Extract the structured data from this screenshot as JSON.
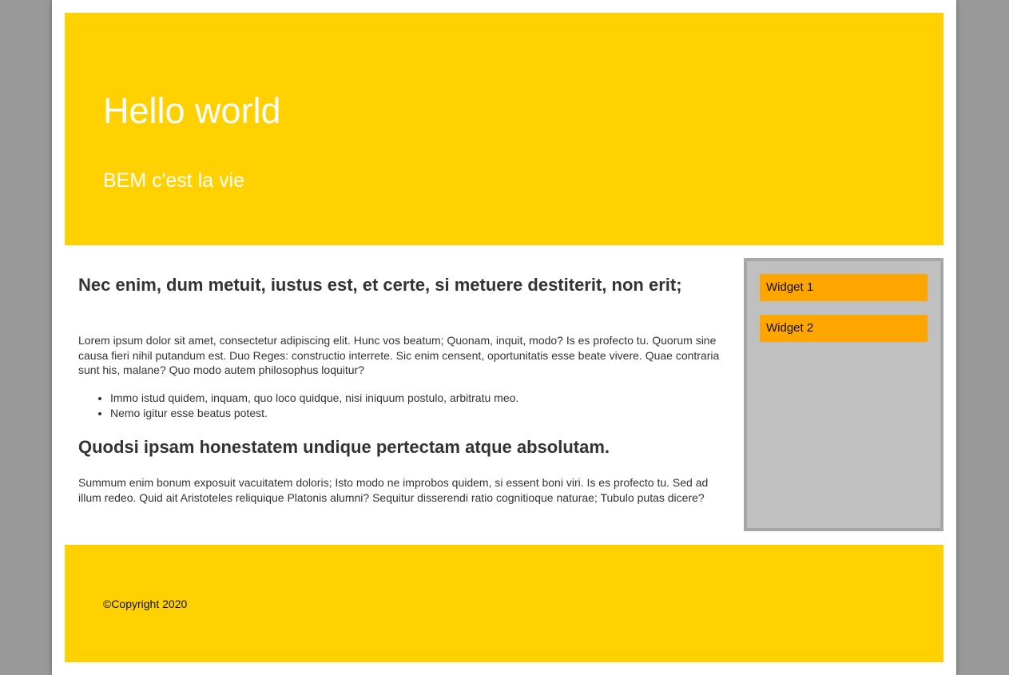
{
  "colors": {
    "backdrop": "#999999",
    "page": "#ffffff",
    "header_bg": "#ffd100",
    "footer_bg": "#ffd100",
    "widget_bg": "#ffa500",
    "sidebar_bg": "#c0c0c0",
    "sidebar_border": "#a6a6a6",
    "text": "#333333"
  },
  "header": {
    "title": "Hello world",
    "subtitle": "BEM c'est la vie"
  },
  "main": {
    "heading1": "Nec enim, dum metuit, iustus est, et certe, si metuere destiterit, non erit;",
    "paragraph1": "Lorem ipsum dolor sit amet, consectetur adipiscing elit. Hunc vos beatum; Quonam, inquit, modo? Is es profecto tu. Quorum sine causa fieri nihil putandum est. Duo Reges: constructio interrete. Sic enim censent, oportunitatis esse beate vivere. Quae contraria sunt his, malane? Quo modo autem philosophus loquitur?",
    "bullets": [
      "Immo istud quidem, inquam, quo loco quidque, nisi iniquum postulo, arbitratu meo.",
      "Nemo igitur esse beatus potest."
    ],
    "heading2": "Quodsi ipsam honestatem undique pertectam atque absolutam.",
    "paragraph2": "Summum enim bonum exposuit vacuitatem doloris; Isto modo ne improbos quidem, si essent boni viri. Is es profecto tu. Sed ad illum redeo. Quid ait Aristoteles reliquique Platonis alumni? Sequitur disserendi ratio cognitioque naturae; Tubulo putas dicere?"
  },
  "sidebar": {
    "widgets": [
      "Widget 1",
      "Widget 2"
    ]
  },
  "footer": {
    "copyright": "©Copyright 2020"
  }
}
